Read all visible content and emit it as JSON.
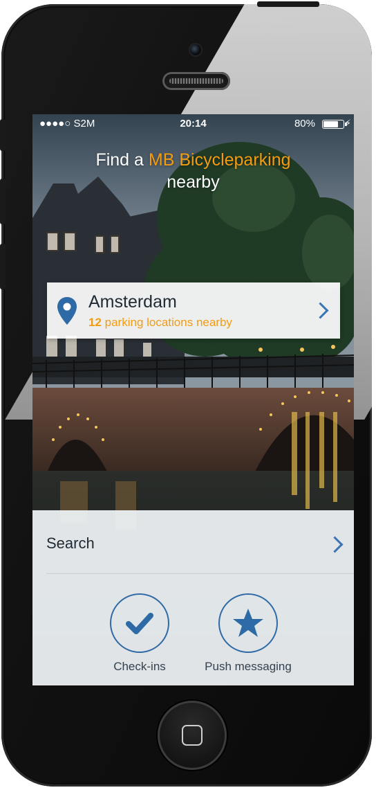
{
  "status_bar": {
    "carrier": "●●●●○ S2M",
    "time": "20:14",
    "battery": "80%",
    "battery_level": 0.8,
    "charging_icon": "bolt-icon"
  },
  "headline": {
    "prefix": "Find a ",
    "brand": "MB Bicycleparking",
    "suffix": "nearby"
  },
  "location": {
    "city": "Amsterdam",
    "count": "12",
    "nearby_text": " parking locations nearby",
    "icon": "map-pin-icon"
  },
  "search": {
    "label": "Search"
  },
  "actions": [
    {
      "label": "Check-ins",
      "icon": "checkmark-icon"
    },
    {
      "label": "Push messaging",
      "icon": "star-icon"
    }
  ],
  "colors": {
    "accent": "#f39c12",
    "primary": "#2e6aa6",
    "phone_body": "#111111"
  }
}
